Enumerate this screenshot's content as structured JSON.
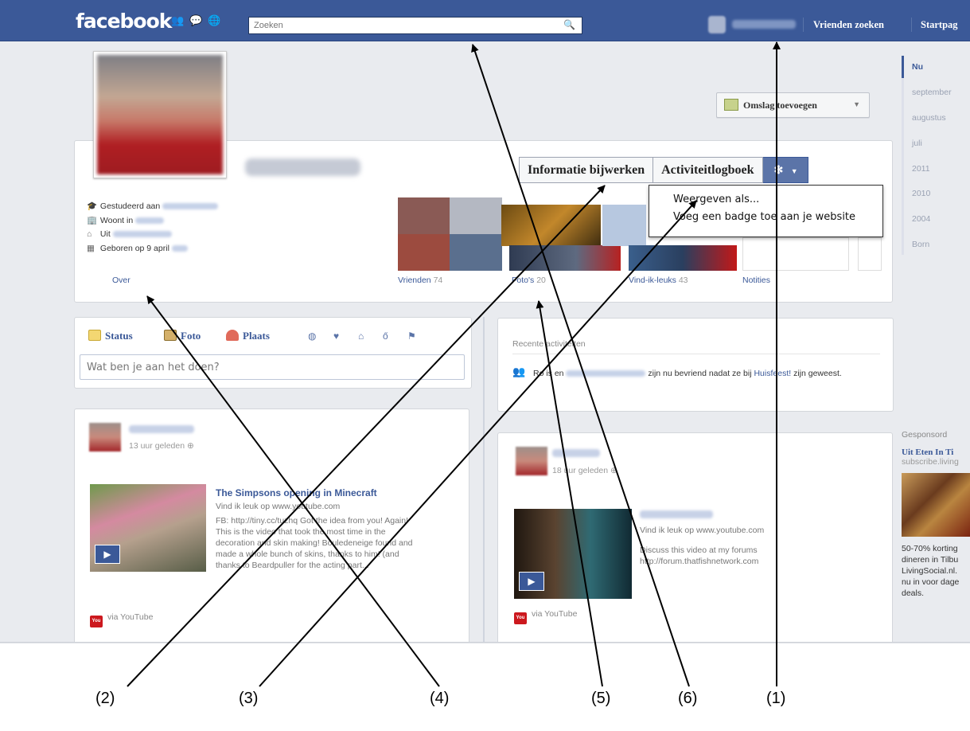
{
  "header": {
    "logo": "facebook",
    "search_placeholder": "Zoeken",
    "links": [
      "Vrienden zoeken",
      "Startpag"
    ]
  },
  "timeline_nav": {
    "items": [
      "Nu",
      "september",
      "augustus",
      "juli",
      "2011",
      "2010",
      "2004",
      "Born"
    ],
    "active": "Nu"
  },
  "cover": {
    "add_cover_label": "Omslag toevoegen"
  },
  "profile_actions": {
    "update_info": "Informatie bijwerken",
    "activity_log": "Activiteitlogboek"
  },
  "settings_menu": {
    "items": [
      "Weergeven als...",
      "Voeg een badge toe aan je website"
    ]
  },
  "about": {
    "studied": "Gestudeerd aan",
    "lives_in": "Woont in",
    "from": "Uit",
    "born": "Geboren op 9 april"
  },
  "sections": [
    {
      "label": "Over",
      "count": ""
    },
    {
      "label": "Vrienden",
      "count": "74"
    },
    {
      "label": "Foto's",
      "count": "20"
    },
    {
      "label": "Vind-ik-leuks",
      "count": "43"
    },
    {
      "label": "Notities",
      "count": ""
    }
  ],
  "composer": {
    "tabs": [
      "Status",
      "Foto",
      "Plaats"
    ],
    "placeholder": "Wat ben je aan het doen?"
  },
  "recent": {
    "heading": "Recente activiteiten",
    "text_start": "Ro  is en",
    "text_mid": "zijn nu bevriend nadat ze bij",
    "text_link": "Huisfeest!",
    "text_end": "zijn geweest."
  },
  "posts": [
    {
      "time": "13 uur geleden",
      "video_title": "The Simpsons opening in Minecraft",
      "video_source": "Vind ik leuk op www.youtube.com",
      "video_desc": "FB: http://tiny.cc/tuzhq Got the idea from you! Again! This is the video that took the most time in the decoration and skin making! Bouledeneige found and made a whole bunch of skins, thanks to him! (and thanks to Beardpuller for the acting part...",
      "via": "via YouTube"
    },
    {
      "time": "18 uur geleden",
      "video_source": "Vind ik leuk op www.youtube.com",
      "video_desc": "Discuss this video at my forums http://forum.thatfishnetwork.com",
      "via": "via YouTube"
    }
  ],
  "sponsored": {
    "heading": "Gesponsord",
    "title": "Uit Eten In Ti",
    "url": "subscribe.living",
    "desc": "50-70% korting\ndineren in Tilbu\nLivingSocial.nl.\nnu in voor dage\ndeals."
  },
  "callouts": [
    "(2)",
    "(3)",
    "(4)",
    "(5)",
    "(6)",
    "(1)"
  ]
}
